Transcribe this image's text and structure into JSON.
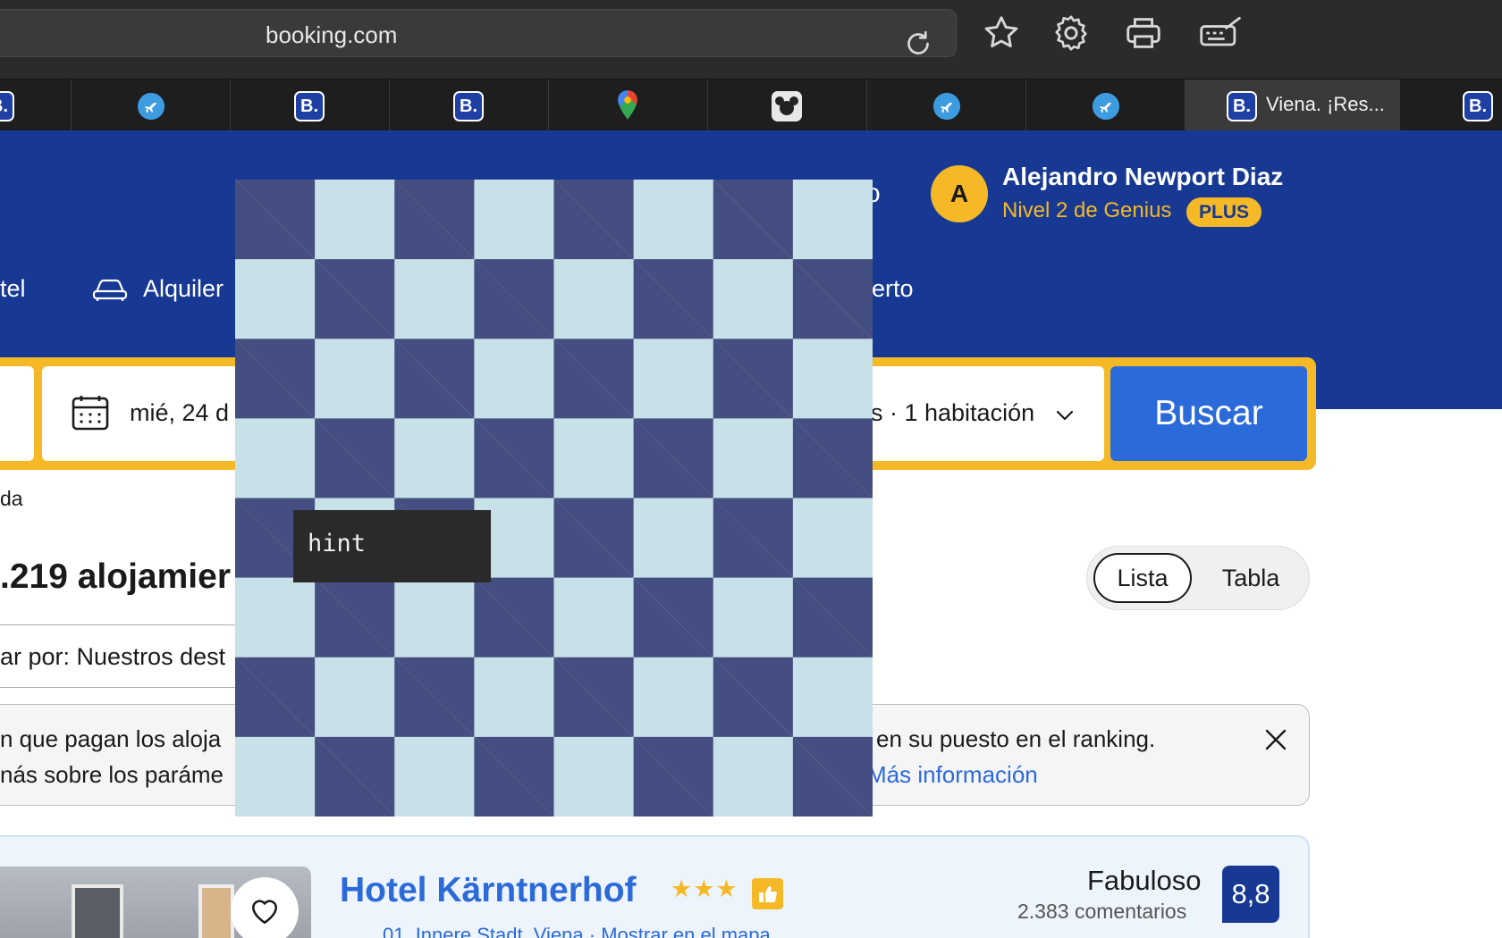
{
  "browser": {
    "url": "booking.com",
    "active_tab_title": "Viena. ¡Res...",
    "tabs": [
      {
        "icon": "booking-icon"
      },
      {
        "icon": "airplane-icon"
      },
      {
        "icon": "booking-icon"
      },
      {
        "icon": "booking-icon"
      },
      {
        "icon": "google-maps-icon"
      },
      {
        "icon": "mickey-icon"
      },
      {
        "icon": "airplane-icon"
      },
      {
        "icon": "airplane-icon"
      },
      {
        "icon": "booking-icon",
        "title": "Viena. ¡Res..."
      },
      {
        "icon": "booking-icon"
      }
    ],
    "favicon_letter": "B."
  },
  "header": {
    "avatar_initial": "A",
    "user_name": "Alejandro Newport Diaz",
    "genius_level": "Nivel 2 de Genius",
    "plus_badge": "PLUS",
    "nav": {
      "hotel_partial": "tel",
      "car_rental_partial": "Alquiler",
      "airport_partial": "erto",
      "header_partial_o": "o"
    }
  },
  "search": {
    "date_partial": "mié, 24 d",
    "guests_partial": "s · 1 habitación",
    "button": "Buscar"
  },
  "results": {
    "breadcrumb_partial": "da",
    "count_partial": ".219 alojamier",
    "view_toggle": {
      "list": "Lista",
      "table": "Tabla"
    },
    "sort_partial": "ar por: Nuestros dest"
  },
  "notice": {
    "line1_left": "n que pagan los aloja",
    "line1_right": "en su puesto en el ranking.",
    "line2_left": "nás sobre los paráme",
    "link": "Más información"
  },
  "hotel": {
    "name": "Hotel Kärntnerhof",
    "stars": "★★★",
    "location_partial": "01. Innere Stadt, Viena  ·  Mostrar en el mapa",
    "rating_word": "Fabuloso",
    "review_count": "2.383 comentarios",
    "score": "8,8"
  },
  "overlay": {
    "hint": "hint"
  },
  "colors": {
    "booking_blue": "#173993",
    "genius_yellow": "#f5b928",
    "button_blue": "#2b6ad9",
    "checker_dark": "#454e80",
    "checker_light": "#c8e0e8"
  }
}
